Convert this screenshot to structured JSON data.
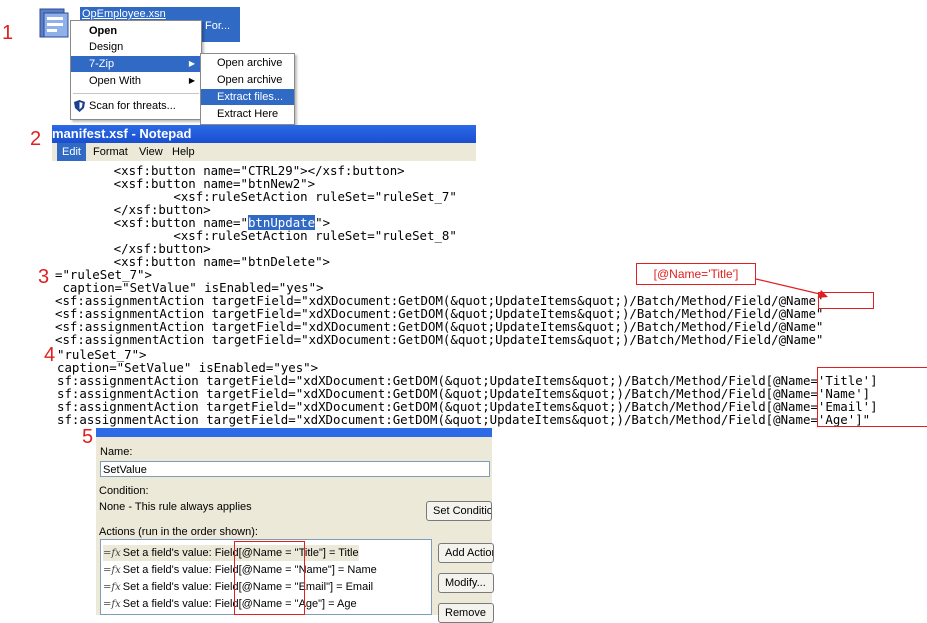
{
  "steps": [
    "1",
    "2",
    "3",
    "4",
    "5"
  ],
  "explorer": {
    "file_name": "OpEmployee.xsn",
    "file_sub": "For...",
    "icon": "infopath-form-icon"
  },
  "context_menu": {
    "items": [
      {
        "label": "Open"
      },
      {
        "label": "Design"
      },
      {
        "label": "7-Zip"
      },
      {
        "label": "Open With"
      },
      {
        "label": "Scan for threats..."
      }
    ]
  },
  "zip_submenu": {
    "items": [
      {
        "label": "Open archive"
      },
      {
        "label": "Open archive"
      },
      {
        "label": "Extract files..."
      },
      {
        "label": "Extract Here"
      }
    ]
  },
  "notepad": {
    "title": "manifest.xsf - Notepad",
    "menus": [
      {
        "label": "Edit"
      },
      {
        "label": "Format"
      },
      {
        "label": "View"
      },
      {
        "label": "Help"
      }
    ],
    "lines": [
      "        <xsf:button name=\"CTRL29\"></xsf:button>",
      "        <xsf:button name=\"btnNew2\">",
      "                <xsf:ruleSetAction ruleSet=\"ruleSet_7\"",
      "        </xsf:button>",
      "        <xsf:button name=\"",
      "                <xsf:ruleSetAction ruleSet=\"ruleSet_8\"",
      "        </xsf:button>",
      "        <xsf:button name=\"btnDelete\">"
    ],
    "selected_word": "btnUpdate",
    "selected_after": "\">"
  },
  "section3": {
    "lines": [
      "=\"ruleSet_7\">",
      " caption=\"SetValue\" isEnabled=\"yes\">",
      "<sf:assignmentAction targetField=\"xdXDocument:GetDOM(&quot;UpdateItems&quot;)/Batch/Method/Field/@Name\"",
      "<sf:assignmentAction targetField=\"xdXDocument:GetDOM(&quot;UpdateItems&quot;)/Batch/Method/Field/@Name\"",
      "<sf:assignmentAction targetField=\"xdXDocument:GetDOM(&quot;UpdateItems&quot;)/Batch/Method/Field/@Name\"",
      "<sf:assignmentAction targetField=\"xdXDocument:GetDOM(&quot;UpdateItems&quot;)/Batch/Method/Field/@Name\""
    ],
    "callout": "[@Name='Title']"
  },
  "section4": {
    "lines": [
      "\"ruleSet_7\">",
      "caption=\"SetValue\" isEnabled=\"yes\">",
      "sf:assignmentAction targetField=\"xdXDocument:GetDOM(&quot;UpdateItems&quot;)/Batch/Method/Field[@Name='Title']",
      "sf:assignmentAction targetField=\"xdXDocument:GetDOM(&quot;UpdateItems&quot;)/Batch/Method/Field[@Name='Name']",
      "sf:assignmentAction targetField=\"xdXDocument:GetDOM(&quot;UpdateItems&quot;)/Batch/Method/Field[@Name='Email']",
      "sf:assignmentAction targetField=\"xdXDocument:GetDOM(&quot;UpdateItems&quot;)/Batch/Method/Field[@Name='Age']\""
    ]
  },
  "rule_dialog": {
    "name_label": "Name:",
    "name_value": "SetValue",
    "condition_label": "Condition:",
    "condition_value": "None - This rule always applies",
    "set_condition_button": "Set Condition...",
    "actions_label": "Actions (run in the order shown):",
    "actions": [
      {
        "prefix": "Set a field's value: Field",
        "field": "[@Name = \"Title\"]",
        "suffix": " = Title"
      },
      {
        "prefix": "Set a field's value: Field",
        "field": "[@Name = \"Name\"]",
        "suffix": " = Name"
      },
      {
        "prefix": "Set a field's value: Field",
        "field": "[@Name = \"Email\"]",
        "suffix": " = Email"
      },
      {
        "prefix": "Set a field's value: Field",
        "field": "[@Name = \"Age\"]",
        "suffix": " = Age"
      }
    ],
    "add_action_button": "Add Action...",
    "modify_button": "Modify...",
    "remove_button": "Remove"
  },
  "colors": {
    "annotation_red": "#e02020",
    "selection_blue": "#316ac5",
    "titlebar_blue": "#2c6ae6",
    "dialog_bg": "#ece9d8"
  }
}
